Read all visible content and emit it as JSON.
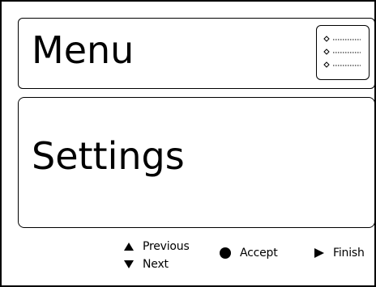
{
  "header": {
    "title": "Menu",
    "icon": "list-icon"
  },
  "main": {
    "title": "Settings"
  },
  "footer": {
    "previous_label": "Previous",
    "next_label": "Next",
    "accept_label": "Accept",
    "finish_label": "Finish",
    "icons": {
      "previous": "triangle-up-icon",
      "next": "triangle-down-icon",
      "accept": "circle-icon",
      "finish": "triangle-right-icon"
    }
  },
  "colors": {
    "foreground": "#000000",
    "background": "#ffffff"
  }
}
